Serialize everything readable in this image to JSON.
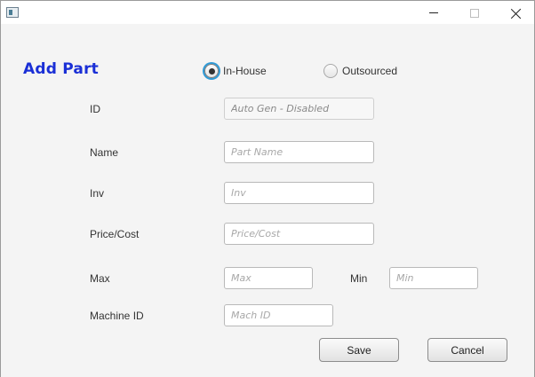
{
  "window": {
    "icon": "app-window-icon",
    "controls": [
      "minimize-icon",
      "maximize-icon",
      "close-icon"
    ]
  },
  "form": {
    "title": "Add Part",
    "source_options": [
      {
        "label": "In-House",
        "selected": true
      },
      {
        "label": "Outsourced",
        "selected": false
      }
    ],
    "fields": {
      "id": {
        "label": "ID",
        "placeholder": "Auto Gen - Disabled",
        "value": ""
      },
      "name": {
        "label": "Name",
        "placeholder": "Part Name",
        "value": ""
      },
      "inv": {
        "label": "Inv",
        "placeholder": "Inv",
        "value": ""
      },
      "price": {
        "label": "Price/Cost",
        "placeholder": "Price/Cost",
        "value": ""
      },
      "max": {
        "label": "Max",
        "placeholder": "Max",
        "value": ""
      },
      "min": {
        "label": "Min",
        "placeholder": "Min",
        "value": ""
      },
      "machine_id": {
        "label": "Machine ID",
        "placeholder": "Mach ID",
        "value": ""
      }
    },
    "buttons": {
      "save": "Save",
      "cancel": "Cancel"
    }
  },
  "colors": {
    "heading": "#1a2fd6",
    "radio_focus": "#2f9ad6",
    "background": "#f4f4f4"
  }
}
